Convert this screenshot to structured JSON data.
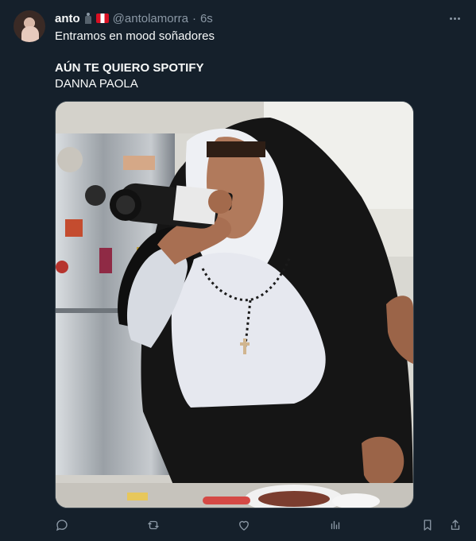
{
  "tweet": {
    "display_name": "anto",
    "handle": "@antolamorra",
    "separator": "·",
    "time": "6s",
    "text": "Entramos en mood soñadores",
    "song_title": "AÚN TE QUIERO SPOTIFY",
    "artist": "DANNA PAOLA"
  },
  "icons": {
    "avatar": "profile-avatar",
    "chess": "chess-pawn-icon",
    "flag": "peru-flag",
    "more": "more-icon",
    "reply": "reply-icon",
    "retweet": "retweet-icon",
    "like": "heart-icon",
    "views": "views-icon",
    "bookmark": "bookmark-icon",
    "share": "share-icon"
  },
  "colors": {
    "background": "#15202b",
    "text": "#f7f9f9",
    "secondary": "#8b98a5",
    "border": "#38444d"
  }
}
